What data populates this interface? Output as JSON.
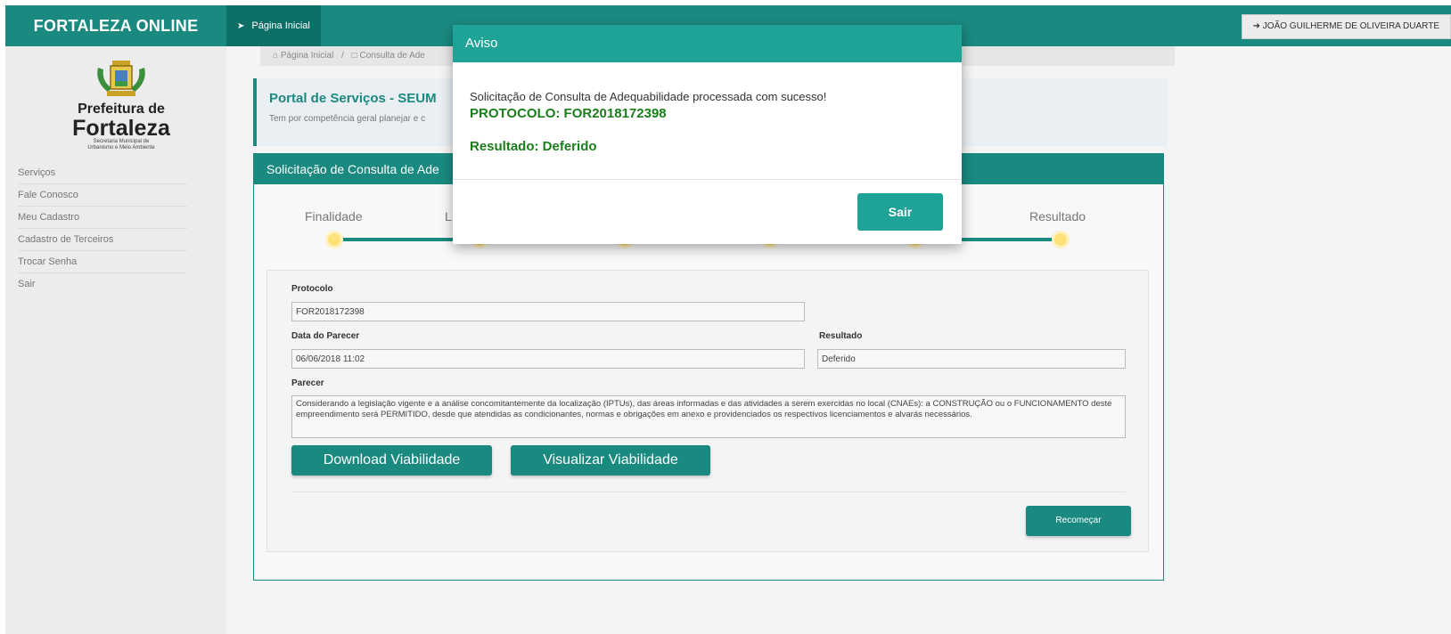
{
  "topbar": {
    "brand": "FORTALEZA ONLINE",
    "nav_item": "Página Inicial",
    "user_button": "JOÃO GUILHERME DE OLIVEIRA DUARTE"
  },
  "sidebar": {
    "logo": {
      "title1": "Prefeitura de",
      "title2": "Fortaleza",
      "sub1": "Secretaria Municipal de",
      "sub2": "Urbanismo e Meio Ambiente"
    },
    "items": [
      {
        "label": "Serviços"
      },
      {
        "label": "Fale Conosco"
      },
      {
        "label": "Meu Cadastro"
      },
      {
        "label": "Cadastro de Terceiros"
      },
      {
        "label": "Trocar Senha"
      },
      {
        "label": "Sair"
      }
    ]
  },
  "breadcrumb": {
    "home": "Página Inicial",
    "current": "Consulta de Ade"
  },
  "portal": {
    "title": "Portal de Serviços - SEUM",
    "description": "Tem por competência geral planejar e c"
  },
  "panel": {
    "title": "Solicitação de Consulta de Ade",
    "steps": [
      {
        "label": "Finalidade"
      },
      {
        "label": "L"
      },
      {
        "label": ""
      },
      {
        "label": ""
      },
      {
        "label": ""
      },
      {
        "label": "Resultado"
      }
    ],
    "form": {
      "protocolo_label": "Protocolo",
      "protocolo_value": "FOR2018172398",
      "data_label": "Data do Parecer",
      "data_value": "06/06/2018 11:02",
      "resultado_label": "Resultado",
      "resultado_value": "Deferido",
      "parecer_label": "Parecer",
      "parecer_value": "Considerando a legislação vigente e a análise concomitantemente da localização (IPTUs), das áreas informadas e das atividades a serem exercidas no local (CNAEs): a CONSTRUÇÃO ou o FUNCIONAMENTO deste empreendimento será PERMITIDO, desde que atendidas as condicionantes, normas e obrigações em anexo e providenciados os respectivos licenciamentos e alvarás necessários."
    },
    "download_button": "Download Viabilidade",
    "visualizar_button": "Visualizar Viabilidade",
    "recomecar_button": "Recomeçar"
  },
  "modal": {
    "title": "Aviso",
    "message": "Solicitação de Consulta de Adequabilidade processada com sucesso!",
    "protocolo": "PROTOCOLO: FOR2018172398",
    "resultado": "Resultado: Deferido",
    "sair_button": "Sair"
  },
  "colors": {
    "primary": "#1a8a80",
    "modal_header": "#1fa396",
    "success_text": "#1b7d1b",
    "step_dot": "#ffe17a"
  }
}
